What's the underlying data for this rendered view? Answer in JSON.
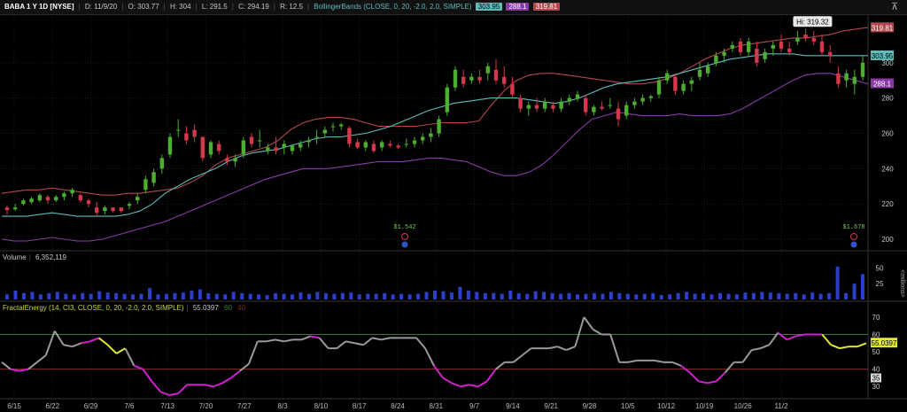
{
  "header": {
    "symbol": "BABA 1 Y 1D [NYSE]",
    "date": "D: 11/9/20",
    "open": "O: 303.77",
    "high": "H: 304",
    "low": "L: 291.5",
    "close": "C: 294.19",
    "range": "R: 12.5",
    "study": "BollingerBands (CLOSE, 0, 20, -2.0, 2.0, SIMPLE)",
    "mid_value": "303.95",
    "lower_value": "288.1",
    "upper_value": "319.81"
  },
  "volume_panel": {
    "label": "Volume",
    "value": "6,352,119",
    "axis_unit": "<millions>",
    "ticks": [
      "50",
      "25"
    ]
  },
  "fractal_panel": {
    "label": "FractalEnergy (14, CI3, CLOSE, 0, 20, -2.0, 2.0, SIMPLE)",
    "value": "55.0397",
    "level_high": "60",
    "level_low": "40",
    "ticks": [
      "70",
      "60",
      "50",
      "40",
      "35",
      "30"
    ],
    "current_label": "55.0397"
  },
  "price_axis": {
    "ticks": [
      "300",
      "280",
      "260",
      "240",
      "220",
      "200"
    ],
    "hi_marker": "Hi: 319.32",
    "upper_label": "319.81",
    "mid_label": "303.95",
    "lower_label": "288.1"
  },
  "dividends": [
    {
      "label": "$1.542",
      "date": "8/20"
    },
    {
      "label": "$1.678",
      "date": "11/5"
    }
  ],
  "x_axis": [
    "6/15",
    "6/22",
    "6/29",
    "7/6",
    "7/13",
    "7/20",
    "7/27",
    "8/3",
    "8/10",
    "8/17",
    "8/24",
    "8/31",
    "9/7",
    "9/14",
    "9/21",
    "9/28",
    "10/5",
    "10/12",
    "10/19",
    "10/26",
    "11/2"
  ],
  "colors": {
    "up": "#4caf30",
    "down": "#d4384c",
    "upper_band": "#b2474f",
    "mid_band": "#5fbcbc",
    "lower_band": "#8a3aa6",
    "volume": "#2b3fc7",
    "fe_gray": "#9a9a9a",
    "fe_magenta": "#d21fd2",
    "fe_yellow": "#e0e838"
  },
  "chart_data": {
    "type": "candlestick",
    "price_ylim": [
      195,
      327
    ],
    "volume_ylim": [
      0,
      56
    ],
    "fe_ylim": [
      24,
      73
    ],
    "candles_ohlc": [
      [
        218,
        219,
        214,
        216.5
      ],
      [
        217,
        220,
        216,
        218
      ],
      [
        220,
        223,
        219,
        222
      ],
      [
        221,
        224,
        220,
        223
      ],
      [
        222,
        226,
        221,
        225
      ],
      [
        224,
        225,
        220,
        222
      ],
      [
        222,
        225,
        221,
        224
      ],
      [
        224,
        227,
        222,
        226
      ],
      [
        226,
        229,
        224,
        228
      ],
      [
        225,
        226,
        221,
        222
      ],
      [
        222,
        223,
        218,
        220
      ],
      [
        218,
        221,
        213,
        215
      ],
      [
        216,
        219,
        214,
        218
      ],
      [
        218,
        218,
        215,
        216
      ],
      [
        218,
        218,
        215,
        216
      ],
      [
        219,
        221,
        217,
        220
      ],
      [
        222,
        226,
        220,
        224
      ],
      [
        228,
        236,
        226,
        234
      ],
      [
        232,
        240,
        230,
        238
      ],
      [
        240,
        248,
        237,
        246
      ],
      [
        248,
        260,
        246,
        258
      ],
      [
        262,
        268,
        258,
        262
      ],
      [
        260,
        264,
        254,
        256
      ],
      [
        262,
        265,
        255,
        258
      ],
      [
        258,
        258,
        244,
        246
      ],
      [
        248,
        256,
        246,
        255
      ],
      [
        254,
        256,
        248,
        250
      ],
      [
        246,
        248,
        242,
        244
      ],
      [
        244,
        248,
        241,
        246
      ],
      [
        248,
        258,
        246,
        256
      ],
      [
        258,
        260,
        252,
        254
      ],
      [
        256,
        262,
        252,
        256
      ],
      [
        250,
        254,
        248,
        252
      ],
      [
        252,
        258,
        248,
        250
      ],
      [
        252,
        256,
        248,
        254
      ],
      [
        250,
        254,
        248,
        253
      ],
      [
        252,
        256,
        250,
        254
      ],
      [
        255,
        258,
        252,
        256
      ],
      [
        258,
        262,
        254,
        258
      ],
      [
        260,
        264,
        258,
        262
      ],
      [
        264,
        266,
        261,
        264
      ],
      [
        264,
        266,
        262,
        265
      ],
      [
        263,
        264,
        252,
        254
      ],
      [
        255,
        257,
        251,
        252
      ],
      [
        252,
        256,
        250,
        255
      ],
      [
        254,
        256,
        249,
        250
      ],
      [
        252,
        256,
        250,
        255
      ],
      [
        254,
        256,
        252,
        253
      ],
      [
        253,
        254,
        251,
        252
      ],
      [
        254,
        257,
        252,
        254
      ],
      [
        254,
        258,
        252,
        256
      ],
      [
        256,
        260,
        254,
        258
      ],
      [
        258,
        263,
        255,
        260
      ],
      [
        260,
        270,
        258,
        268
      ],
      [
        272,
        288,
        270,
        286
      ],
      [
        286,
        298,
        284,
        296
      ],
      [
        292,
        296,
        286,
        288
      ],
      [
        290,
        294,
        288,
        292
      ],
      [
        292,
        296,
        288,
        290
      ],
      [
        294,
        300,
        290,
        298
      ],
      [
        296,
        302,
        288,
        290
      ],
      [
        292,
        298,
        286,
        288
      ],
      [
        288,
        292,
        280,
        282
      ],
      [
        280,
        282,
        272,
        274
      ],
      [
        274,
        278,
        270,
        276
      ],
      [
        276,
        280,
        272,
        274
      ],
      [
        274,
        280,
        272,
        278
      ],
      [
        276,
        278,
        272,
        274
      ],
      [
        274,
        280,
        272,
        278
      ],
      [
        278,
        282,
        276,
        280
      ],
      [
        280,
        284,
        278,
        282
      ],
      [
        280,
        282,
        270,
        272
      ],
      [
        272,
        276,
        270,
        275
      ],
      [
        275,
        278,
        273,
        274
      ],
      [
        276,
        280,
        274,
        276
      ],
      [
        274,
        278,
        264,
        268
      ],
      [
        270,
        278,
        268,
        276
      ],
      [
        276,
        280,
        274,
        278
      ],
      [
        278,
        282,
        276,
        280
      ],
      [
        280,
        282,
        278,
        281
      ],
      [
        282,
        292,
        280,
        290
      ],
      [
        290,
        296,
        288,
        294
      ],
      [
        292,
        294,
        282,
        284
      ],
      [
        284,
        290,
        282,
        288
      ],
      [
        288,
        292,
        284,
        290
      ],
      [
        292,
        300,
        290,
        296
      ],
      [
        294,
        300,
        292,
        298
      ],
      [
        300,
        306,
        298,
        304
      ],
      [
        304,
        308,
        300,
        306
      ],
      [
        308,
        312,
        306,
        310
      ],
      [
        312,
        314,
        304,
        306
      ],
      [
        306,
        314,
        304,
        312
      ],
      [
        308,
        312,
        298,
        300
      ],
      [
        302,
        308,
        300,
        306
      ],
      [
        308,
        312,
        304,
        310
      ],
      [
        312,
        316,
        306,
        308
      ],
      [
        308,
        312,
        304,
        306
      ],
      [
        312,
        318,
        310,
        314
      ],
      [
        316,
        319.32,
        312,
        314
      ],
      [
        314,
        318,
        310,
        312
      ],
      [
        312,
        316,
        304,
        306
      ],
      [
        306,
        310,
        300,
        304
      ],
      [
        294,
        298,
        286,
        288
      ],
      [
        290,
        296,
        286,
        294
      ],
      [
        288,
        296,
        282,
        292
      ],
      [
        292,
        304,
        290,
        300
      ]
    ],
    "upper_band": [
      226,
      227,
      228,
      228,
      229,
      228,
      227,
      226,
      225,
      225,
      226,
      226,
      227,
      228,
      229,
      232,
      236,
      242,
      246,
      248,
      250,
      252,
      256,
      262,
      266,
      268,
      269,
      269,
      268,
      266,
      264,
      264,
      264,
      264,
      265,
      266,
      266,
      266,
      267,
      276,
      284,
      290,
      293,
      294,
      294,
      293,
      292,
      291,
      290,
      289,
      288,
      288,
      289,
      291,
      294,
      298,
      302,
      305,
      308,
      310,
      311,
      312,
      313,
      314,
      314,
      315,
      316,
      318,
      319,
      320
    ],
    "mid_band": [
      213,
      213,
      213,
      214,
      215,
      214,
      213,
      213,
      213,
      213,
      214,
      216,
      220,
      226,
      230,
      234,
      237,
      240,
      244,
      247,
      249,
      250,
      251,
      253,
      255,
      257,
      258,
      258,
      259,
      260,
      262,
      264,
      267,
      270,
      273,
      275,
      277,
      278,
      279,
      280,
      280,
      280,
      279,
      278,
      277,
      278,
      280,
      283,
      286,
      288,
      289,
      290,
      291,
      292,
      294,
      296,
      298,
      300,
      302,
      303,
      304,
      305,
      305,
      305,
      304,
      304,
      304,
      304,
      304,
      304
    ],
    "lower_band": [
      200,
      199,
      199,
      200,
      201,
      200,
      199,
      199,
      200,
      202,
      204,
      206,
      208,
      210,
      213,
      216,
      219,
      222,
      225,
      228,
      231,
      234,
      236,
      238,
      240,
      240,
      240,
      241,
      242,
      243,
      244,
      244,
      244,
      245,
      246,
      246,
      245,
      244,
      241,
      238,
      236,
      236,
      238,
      242,
      248,
      255,
      262,
      268,
      270,
      272,
      271,
      270,
      270,
      270,
      271,
      270,
      270,
      270,
      271,
      274,
      278,
      282,
      286,
      290,
      293,
      294,
      294,
      292,
      290,
      288
    ],
    "volume": [
      8,
      14,
      10,
      12,
      8,
      10,
      12,
      9,
      8,
      10,
      9,
      13,
      11,
      10,
      9,
      8,
      9,
      18,
      8,
      9,
      10,
      11,
      14,
      16,
      10,
      9,
      8,
      12,
      10,
      9,
      8,
      7,
      10,
      9,
      8,
      11,
      9,
      12,
      10,
      9,
      10,
      11,
      8,
      9,
      9,
      10,
      8,
      9,
      8,
      9,
      12,
      14,
      13,
      11,
      20,
      14,
      12,
      10,
      10,
      9,
      14,
      10,
      9,
      13,
      12,
      10,
      9,
      10,
      8,
      9,
      10,
      9,
      12,
      10,
      9,
      8,
      9,
      10,
      7,
      8,
      10,
      12,
      9,
      10,
      8,
      10,
      9,
      8,
      11,
      10,
      12,
      11,
      10,
      9,
      10,
      8,
      11,
      9,
      10,
      52,
      10,
      25,
      40
    ],
    "fractal_energy": [
      44,
      40,
      39,
      40,
      44,
      48,
      62,
      54,
      53,
      55,
      56,
      58,
      54,
      49,
      52,
      42,
      40,
      33,
      27,
      25,
      26,
      31,
      31,
      31,
      30,
      32,
      35,
      39,
      43,
      56,
      56,
      57,
      56,
      57,
      57,
      59,
      58,
      52,
      52,
      56,
      55,
      54,
      58,
      57,
      58,
      58,
      58,
      58,
      52,
      42,
      35,
      32,
      30,
      31,
      30,
      33,
      40,
      44,
      44,
      48,
      52,
      52,
      52,
      53,
      51,
      53,
      70,
      63,
      60,
      60,
      44,
      44,
      45,
      45,
      45,
      44,
      44,
      42,
      38,
      33,
      32,
      33,
      38,
      44,
      44,
      51,
      52,
      54,
      61,
      57,
      59,
      60,
      60,
      60,
      54,
      52,
      53,
      53,
      55
    ]
  }
}
